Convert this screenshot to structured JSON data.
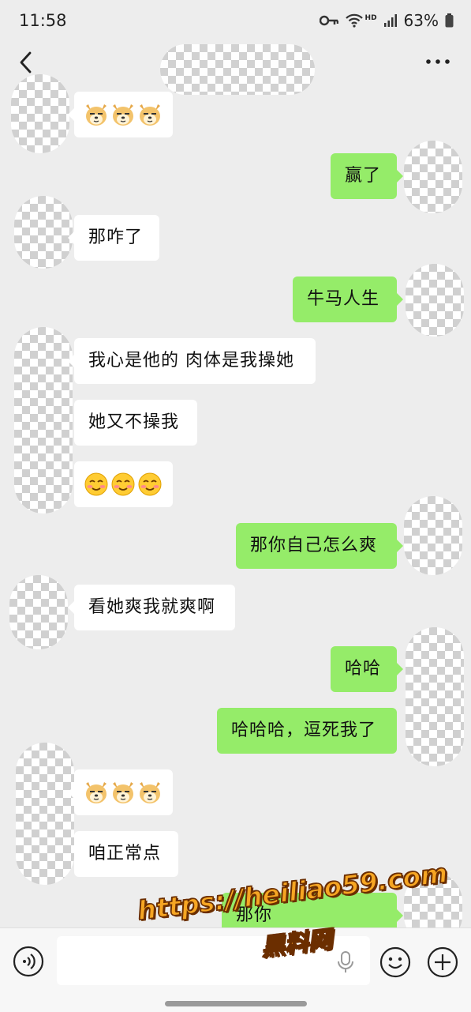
{
  "status_bar": {
    "time": "11:58",
    "network_badge": "HD",
    "battery": "63%"
  },
  "nav": {
    "back_icon": "chevron-left-icon",
    "more_icon": "ellipsis-icon"
  },
  "messages": [
    {
      "side": "in",
      "type": "emoji",
      "emoji": "doge",
      "count": 3
    },
    {
      "side": "out",
      "type": "text",
      "text": "赢了"
    },
    {
      "side": "in",
      "type": "text",
      "text": "那咋了"
    },
    {
      "side": "out",
      "type": "text",
      "text": "牛马人生"
    },
    {
      "side": "in",
      "type": "text",
      "text": "我心是他的 肉体是我操她"
    },
    {
      "side": "in",
      "type": "text",
      "text": "她又不操我"
    },
    {
      "side": "in",
      "type": "emoji",
      "emoji": "smile",
      "count": 3
    },
    {
      "side": "out",
      "type": "text",
      "text": "那你自己怎么爽"
    },
    {
      "side": "in",
      "type": "text",
      "text": "看她爽我就爽啊"
    },
    {
      "side": "out",
      "type": "text",
      "text": "哈哈"
    },
    {
      "side": "out",
      "type": "text",
      "text": "哈哈哈，逗死我了"
    },
    {
      "side": "in",
      "type": "emoji",
      "emoji": "doge",
      "count": 3
    },
    {
      "side": "in",
      "type": "text",
      "text": "咱正常点"
    },
    {
      "side": "out",
      "type": "text",
      "text": "那你"
    }
  ],
  "input_bar": {
    "placeholder": "",
    "icons": [
      "voice-icon",
      "microphone-icon",
      "emoji-icon",
      "plus-icon"
    ]
  },
  "watermark": {
    "url": "https://heiliao59.com",
    "name": "黑料网"
  },
  "colors": {
    "background": "#ededed",
    "outgoing_bubble": "#95ec69",
    "incoming_bubble": "#ffffff",
    "watermark_fill": "#f6a623"
  }
}
